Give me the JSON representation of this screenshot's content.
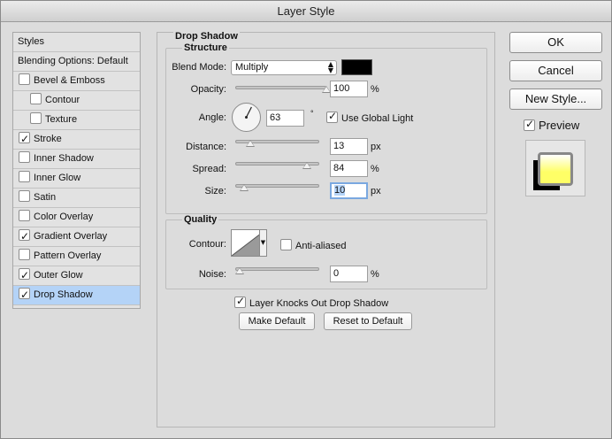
{
  "window": {
    "title": "Layer Style"
  },
  "styles_list": {
    "items": [
      {
        "label": "Styles",
        "type": "header",
        "checked": false,
        "selected": false,
        "indent": false
      },
      {
        "label": "Blending Options: Default",
        "type": "header",
        "checked": false,
        "selected": false,
        "indent": false
      },
      {
        "label": "Bevel & Emboss",
        "type": "check",
        "checked": false,
        "selected": false,
        "indent": false
      },
      {
        "label": "Contour",
        "type": "check",
        "checked": false,
        "selected": false,
        "indent": true
      },
      {
        "label": "Texture",
        "type": "check",
        "checked": false,
        "selected": false,
        "indent": true
      },
      {
        "label": "Stroke",
        "type": "check",
        "checked": true,
        "selected": false,
        "indent": false
      },
      {
        "label": "Inner Shadow",
        "type": "check",
        "checked": false,
        "selected": false,
        "indent": false
      },
      {
        "label": "Inner Glow",
        "type": "check",
        "checked": false,
        "selected": false,
        "indent": false
      },
      {
        "label": "Satin",
        "type": "check",
        "checked": false,
        "selected": false,
        "indent": false
      },
      {
        "label": "Color Overlay",
        "type": "check",
        "checked": false,
        "selected": false,
        "indent": false
      },
      {
        "label": "Gradient Overlay",
        "type": "check",
        "checked": true,
        "selected": false,
        "indent": false
      },
      {
        "label": "Pattern Overlay",
        "type": "check",
        "checked": false,
        "selected": false,
        "indent": false
      },
      {
        "label": "Outer Glow",
        "type": "check",
        "checked": true,
        "selected": false,
        "indent": false
      },
      {
        "label": "Drop Shadow",
        "type": "check",
        "checked": true,
        "selected": true,
        "indent": false
      }
    ]
  },
  "drop_shadow": {
    "title": "Drop Shadow",
    "structure": {
      "title": "Structure",
      "blend_mode_label": "Blend Mode:",
      "blend_mode_value": "Multiply",
      "shadow_color": "#000000",
      "opacity_label": "Opacity:",
      "opacity_value": "100",
      "opacity_level": 1.0,
      "percent_unit": "%",
      "angle_label": "Angle:",
      "angle_value": "63",
      "angle_unit": "°",
      "use_global_light_label": "Use Global Light",
      "use_global_light_checked": true,
      "distance_label": "Distance:",
      "distance_value": "13",
      "distance_level": 0.13,
      "px_unit": "px",
      "spread_label": "Spread:",
      "spread_value": "84",
      "spread_level": 0.84,
      "size_label": "Size:",
      "size_value": "10",
      "size_level": 0.05
    },
    "quality": {
      "title": "Quality",
      "contour_label": "Contour:",
      "anti_aliased_label": "Anti-aliased",
      "anti_aliased_checked": false,
      "noise_label": "Noise:",
      "noise_value": "0",
      "noise_level": 0.0
    },
    "knocks_out_label": "Layer Knocks Out Drop Shadow",
    "knocks_out_checked": true,
    "make_default_label": "Make Default",
    "reset_default_label": "Reset to Default"
  },
  "actions": {
    "ok_label": "OK",
    "cancel_label": "Cancel",
    "new_style_label": "New Style...",
    "preview_label": "Preview",
    "preview_checked": true
  },
  "colors": {
    "selected_row": "#b4d3f7",
    "preview_fill": "#ffff66"
  }
}
